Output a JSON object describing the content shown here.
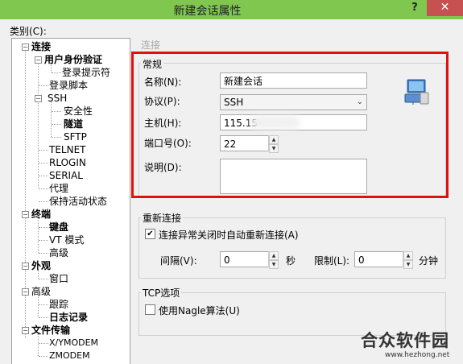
{
  "window": {
    "title": "新建会话属性",
    "help": "?",
    "close": "✕"
  },
  "category_label": "类别(C):",
  "tree": {
    "connection": "连接",
    "user_auth": "用户身份验证",
    "login_prompt": "登录提示符",
    "login_script": "登录脚本",
    "ssh": "SSH",
    "security": "安全性",
    "tunnel": "隧道",
    "sftp": "SFTP",
    "telnet": "TELNET",
    "rlogin": "RLOGIN",
    "serial": "SERIAL",
    "proxy": "代理",
    "keepalive": "保持活动状态",
    "terminal": "终端",
    "keyboard": "键盘",
    "vt_mode": "VT 模式",
    "advanced_t": "高级",
    "appearance": "外观",
    "window": "窗口",
    "advanced": "高级",
    "trace": "跟踪",
    "log": "日志记录",
    "file_transfer": "文件传输",
    "xymodem": "X/YMODEM",
    "zmodem": "ZMODEM"
  },
  "panel": {
    "header_ghost": "连接",
    "general": {
      "title": "常规",
      "name_label": "名称(N):",
      "name_value": "新建会话",
      "protocol_label": "协议(P):",
      "protocol_value": "SSH",
      "host_label": "主机(H):",
      "host_value": "115.15",
      "port_label": "端口号(O):",
      "port_value": "22",
      "desc_label": "说明(D):"
    },
    "reconnect": {
      "title": "重新连接",
      "checkbox_label": "连接异常关闭时自动重新连接(A)",
      "checked": true,
      "interval_label": "间隔(V):",
      "interval_value": "0",
      "seconds": "秒",
      "limit_label": "限制(L):",
      "limit_value": "0",
      "minutes": "分钟"
    },
    "tcp": {
      "title": "TCP选项",
      "nagle_label": "使用Nagle算法(U)",
      "checked": false
    }
  },
  "watermark": {
    "text": "合众软件园",
    "url": "www.hezhong.net"
  },
  "colors": {
    "titlebar": "#7fc74f",
    "close": "#c75050",
    "highlight": "#e01010"
  }
}
